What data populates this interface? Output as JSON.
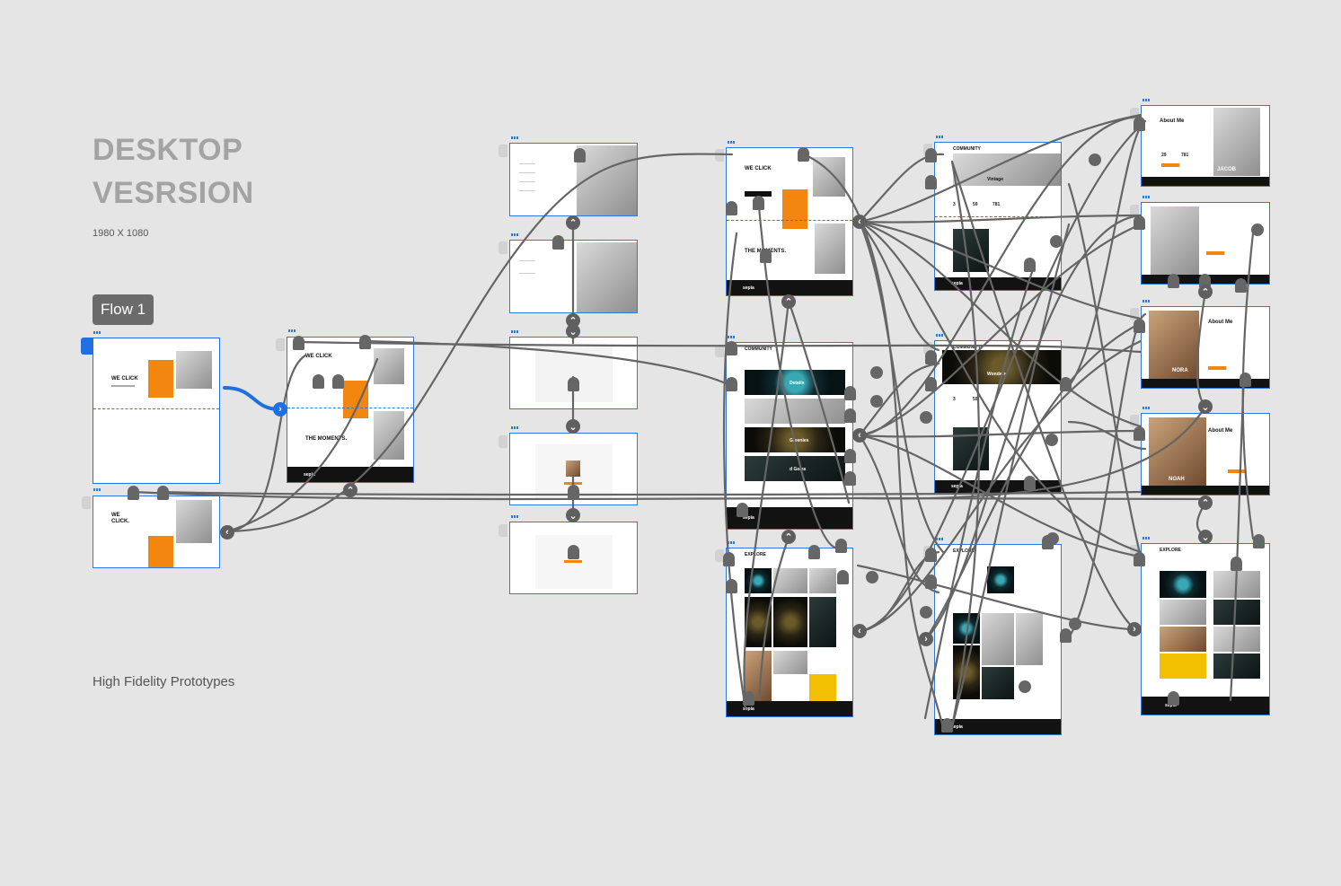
{
  "page": {
    "title_line1": "DESKTOP",
    "title_line2": "VESRSION",
    "size_label": "1980 X 1080",
    "flow_label": "Flow 1",
    "footer_label": "High Fidelity Prototypes"
  },
  "artboard_text": {
    "hero_title": "WE CLICK",
    "hero_title_split": "WE\nCLICK.",
    "moments_title": "THE MOMENTS.",
    "logo": "sepia",
    "community": "COMMUNITY",
    "explore": "EXPLORE",
    "about_me": "About Me",
    "name_jacob": "JACOB",
    "name_nora": "NORA",
    "name_noah": "NOAH",
    "stat_1": "3",
    "stat_2": "59",
    "stat_3": "781",
    "label_vintage": "Vintage",
    "label_wonders": "Wonders",
    "label_gems": "d Gems",
    "label_greenies": "Greenies",
    "label_details": "Details",
    "stat_jacob_1": "29",
    "stat_jacob_2": "781"
  },
  "colors": {
    "canvas": "#e5e5e5",
    "artboard_border": "#2f78dd",
    "wire": "#656565",
    "accent_orange": "#f3860f",
    "active_wire": "#1f6fe0"
  },
  "icons": {
    "connector_back": "chevron-left-icon",
    "connector_forward": "chevron-right-icon",
    "connector_up": "chevron-up-icon",
    "connector_down": "chevron-down-icon"
  }
}
